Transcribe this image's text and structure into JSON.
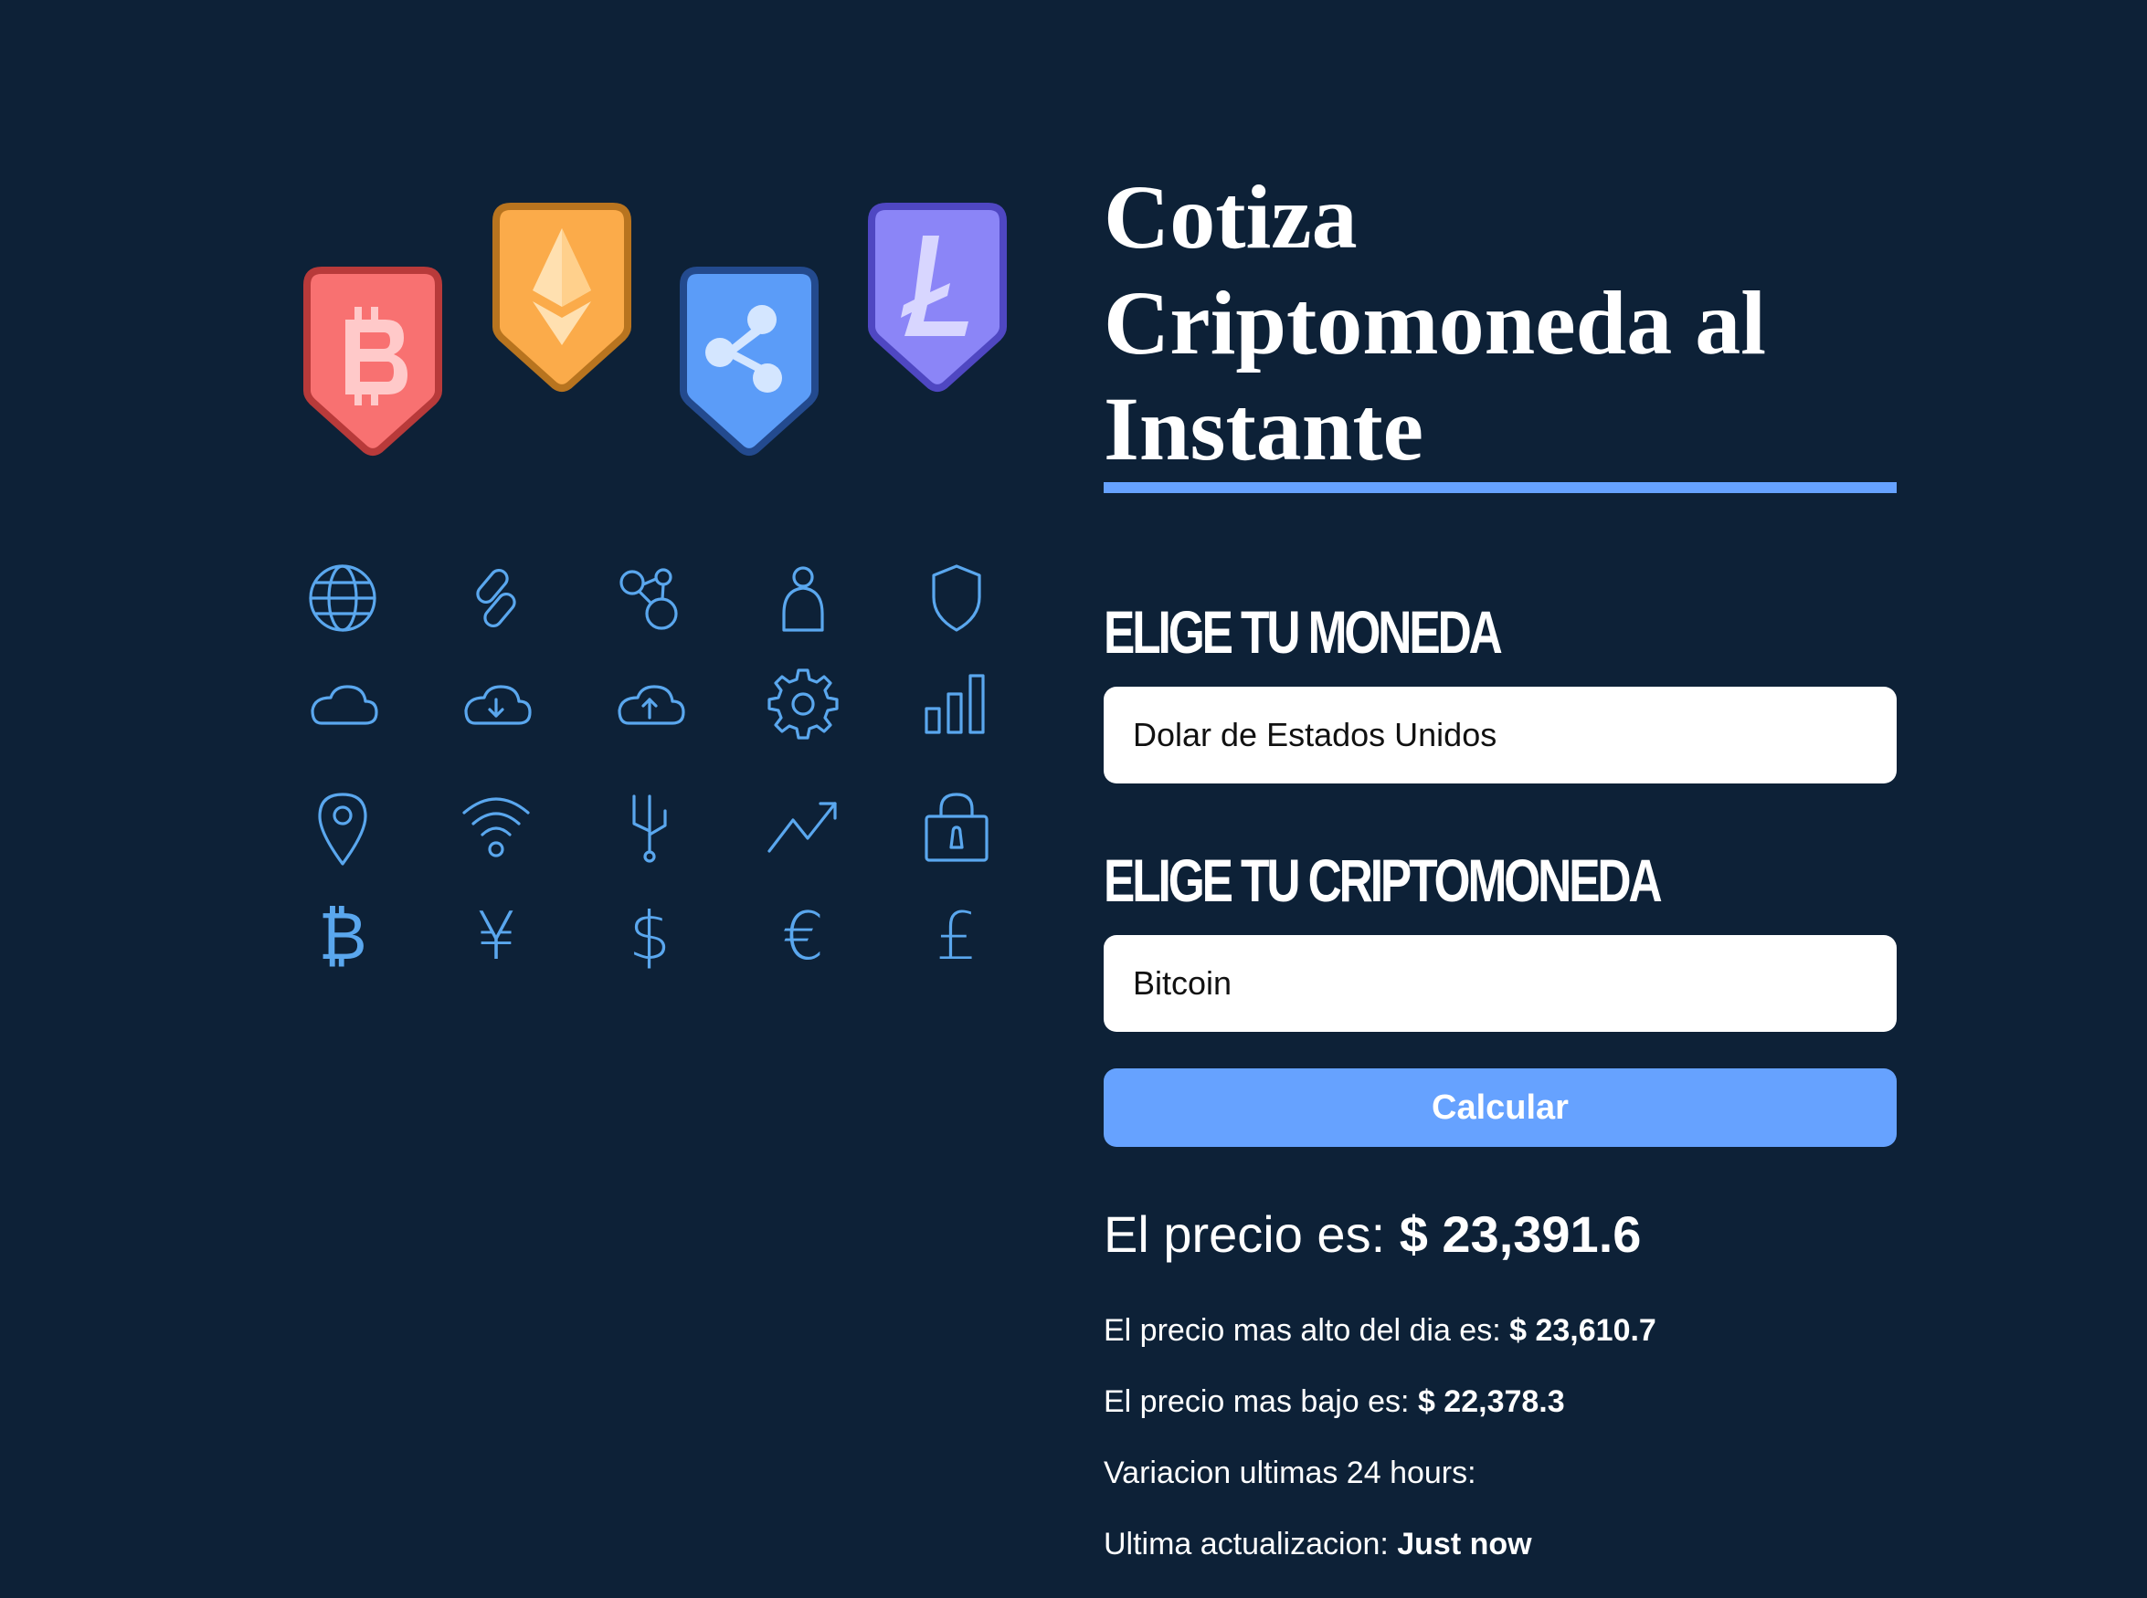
{
  "app": {
    "title_lines": [
      "Cotiza",
      "Criptomoneda al",
      "Instante"
    ]
  },
  "illustration": {
    "badges": [
      {
        "name": "bitcoin",
        "symbol": "bitcoin-icon",
        "color": "#f87171",
        "border": "#b83a3a",
        "symbol_color": "#ffc9c9"
      },
      {
        "name": "ethereum",
        "symbol": "ethereum-icon",
        "color": "#fbab4a",
        "border": "#b8741f",
        "symbol_color": "#ffe0b0"
      },
      {
        "name": "ripple",
        "symbol": "ripple-icon",
        "color": "#5b9cf8",
        "border": "#234a8e",
        "symbol_color": "#d4e6ff"
      },
      {
        "name": "litecoin",
        "symbol": "litecoin-icon",
        "color": "#8b85f7",
        "border": "#4f47c2",
        "symbol_color": "#d8d6ff"
      }
    ],
    "icon_color": "#5aa7ee",
    "grid_icons": [
      "globe-icon",
      "link-icon",
      "network-icon",
      "user-icon",
      "shield-icon",
      "cloud-icon",
      "cloud-download-icon",
      "cloud-upload-icon",
      "gear-icon",
      "bar-chart-icon",
      "location-pin-icon",
      "wifi-icon",
      "usb-icon",
      "trend-up-icon",
      "padlock-icon",
      "bitcoin-sign-icon",
      "yen-sign-icon",
      "dollar-sign-icon",
      "euro-sign-icon",
      "pound-sign-icon"
    ],
    "currency_glyphs": {
      "bitcoin": "₿",
      "yen": "¥",
      "dollar": "$",
      "euro": "€",
      "pound": "£"
    }
  },
  "form": {
    "currency_label": "Elige tu Moneda",
    "currency_selected": "Dolar de Estados Unidos",
    "crypto_label": "Elige tu Criptomoneda",
    "crypto_selected": "Bitcoin",
    "button_label": "Calcular"
  },
  "result": {
    "price_label": "El precio es:",
    "price_value": "$ 23,391.6",
    "high_label": "El precio mas alto del dia es:",
    "high_value": "$ 23,610.7",
    "low_label": "El precio mas bajo es:",
    "low_value": "$ 22,378.3",
    "variation_label": "Variacion ultimas 24 hours:",
    "variation_value": "",
    "updated_label": "Ultima actualizacion:",
    "updated_value": "Just now"
  },
  "colors": {
    "background": "#0d2137",
    "accent": "#66a2ff"
  }
}
